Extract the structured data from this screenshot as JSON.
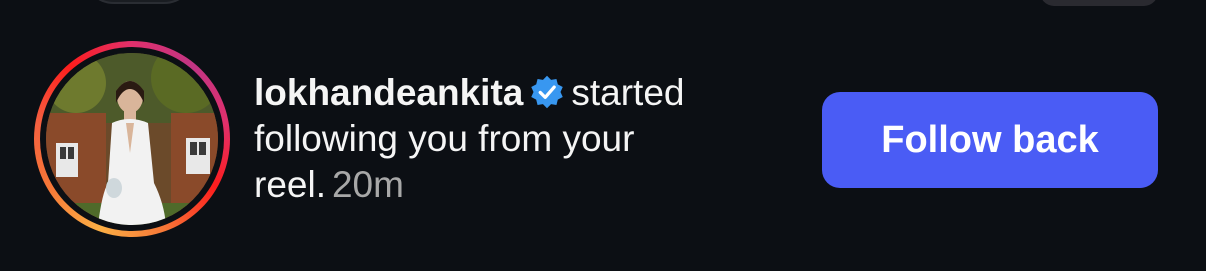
{
  "notification": {
    "username": "lokhandeankita",
    "verified": true,
    "message": "started following you from your reel.",
    "time": "20m",
    "action_label": "Follow back"
  },
  "colors": {
    "background": "#0c0f14",
    "button": "#4a5cf5",
    "verified_badge": "#3897f0",
    "time_text": "#a8a8a8"
  }
}
